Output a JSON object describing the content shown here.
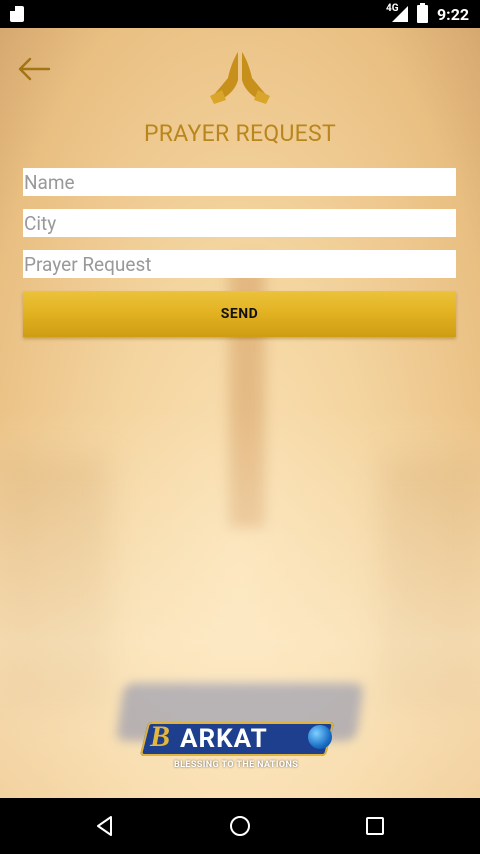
{
  "status_bar": {
    "network": "4G",
    "time": "9:22"
  },
  "header": {
    "back_icon": "arrow-left-icon",
    "logo_icon": "praying-hands-icon",
    "title": "PRAYER REQUEST"
  },
  "form": {
    "name_placeholder": "Name",
    "city_placeholder": "City",
    "request_placeholder": "Prayer Request",
    "send_label": "SEND"
  },
  "branding": {
    "logo_letter": "B",
    "logo_word": "ARKAT",
    "tagline": "BLESSING TO THE NATIONS"
  },
  "colors": {
    "accent": "#b8861c",
    "button": "#e3b323",
    "logo_blue": "#1d3f8e"
  },
  "nav_bar": {
    "icons": [
      "back-triangle-icon",
      "home-circle-icon",
      "recents-square-icon"
    ]
  }
}
